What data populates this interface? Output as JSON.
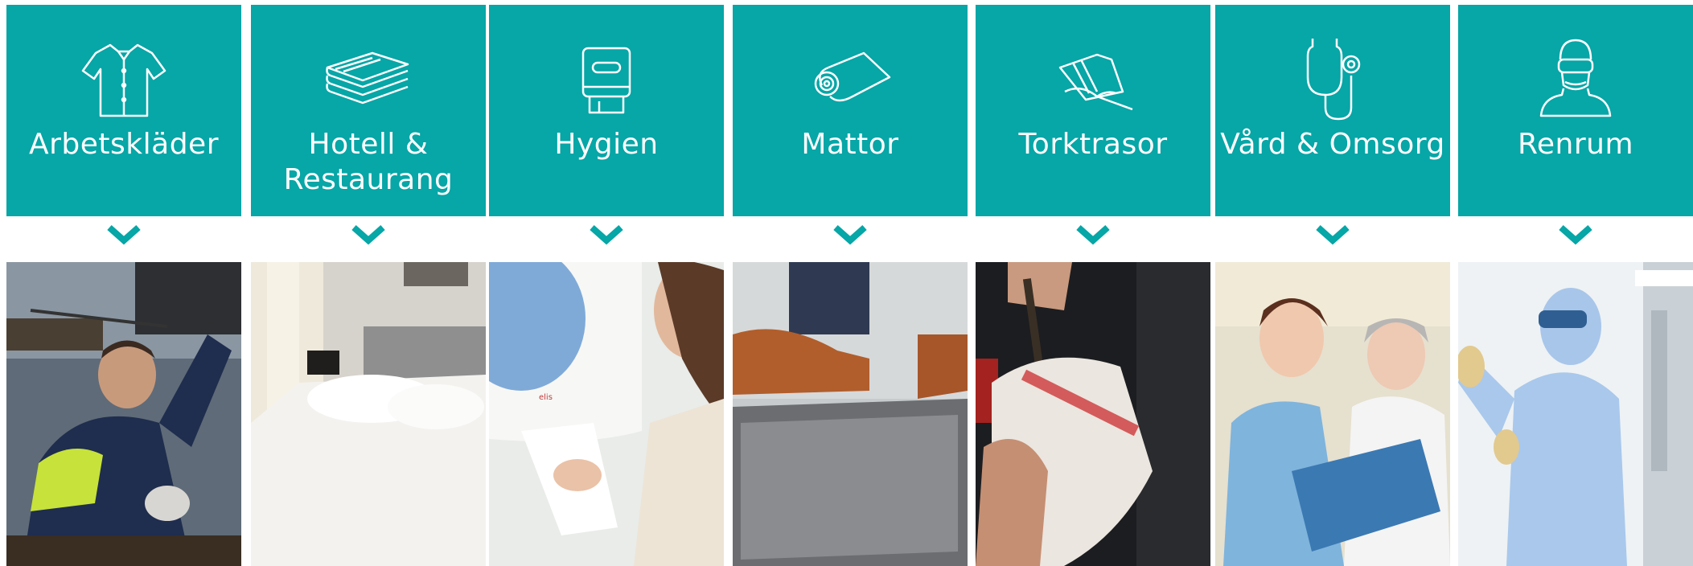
{
  "categories": [
    {
      "label": "Arbetskläder",
      "icon": "shirt-icon",
      "photo": "worker-photo"
    },
    {
      "label": "Hotell & Restaurang",
      "icon": "towels-icon",
      "photo": "hotel-bed-photo"
    },
    {
      "label": "Hygien",
      "icon": "dispenser-icon",
      "photo": "towel-dispenser-photo"
    },
    {
      "label": "Mattor",
      "icon": "mat-roll-icon",
      "photo": "doormat-photo"
    },
    {
      "label": "Torktrasor",
      "icon": "wiping-cloth-icon",
      "photo": "wiping-cloth-photo"
    },
    {
      "label": "Vård & Omsorg",
      "icon": "stethoscope-icon",
      "photo": "nurses-photo"
    },
    {
      "label": "Renrum",
      "icon": "cleanroom-suit-icon",
      "photo": "cleanroom-photo"
    }
  ],
  "photo_texts": {
    "dispenser_brand": "elis"
  },
  "colors": {
    "accent": "#07a6a7",
    "text": "#ffffff"
  }
}
